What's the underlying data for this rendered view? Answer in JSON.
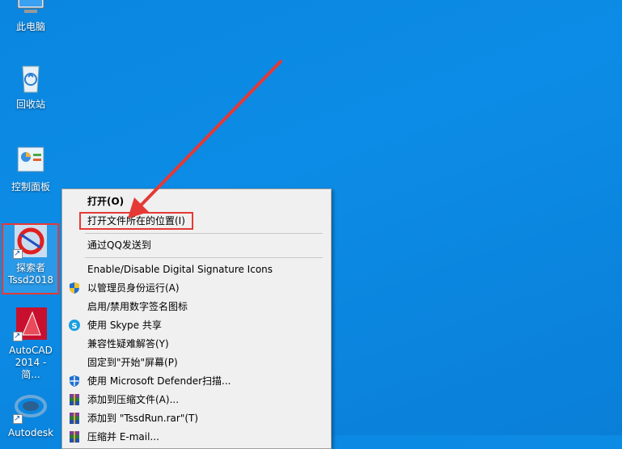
{
  "desktop": {
    "icons": [
      {
        "label": "此电脑"
      },
      {
        "label": "回收站"
      },
      {
        "label": "控制面板"
      },
      {
        "label_line1": "探索者",
        "label_line2": "Tssd2018"
      },
      {
        "label_line1": "AutoCAD",
        "label_line2": "2014 - 简..."
      },
      {
        "label": "Autodesk"
      }
    ]
  },
  "context_menu": {
    "items": [
      {
        "label": "打开(O)"
      },
      {
        "label": "打开文件所在的位置(I)"
      },
      {
        "label": "通过QQ发送到"
      },
      {
        "label": "Enable/Disable Digital Signature Icons"
      },
      {
        "label": "以管理员身份运行(A)",
        "icon": "shield-uac-icon"
      },
      {
        "label": "启用/禁用数字签名图标"
      },
      {
        "label": "使用 Skype 共享",
        "icon": "skype-icon"
      },
      {
        "label": "兼容性疑难解答(Y)"
      },
      {
        "label": "固定到\"开始\"屏幕(P)"
      },
      {
        "label": "使用 Microsoft Defender扫描...",
        "icon": "defender-shield-icon"
      },
      {
        "label": "添加到压缩文件(A)...",
        "icon": "winrar-icon"
      },
      {
        "label": "添加到 \"TssdRun.rar\"(T)",
        "icon": "winrar-icon"
      },
      {
        "label": "压缩并 E-mail...",
        "icon": "winrar-icon"
      }
    ]
  },
  "colors": {
    "highlight_red": "#e53935",
    "desktop_blue": "#0a86e0"
  }
}
